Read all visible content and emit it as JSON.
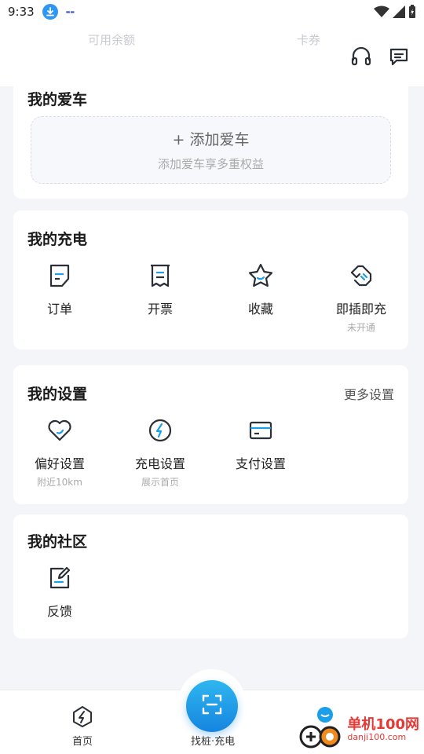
{
  "status_bar": {
    "time": "9:33"
  },
  "header": {
    "balance_label": "可用余额",
    "coupon_label": "卡券"
  },
  "my_car": {
    "title": "我的爱车",
    "add_label": "+ 添加爱车",
    "add_sub": "添加爱车享多重权益"
  },
  "my_charging": {
    "title": "我的充电",
    "items": [
      {
        "label": "订单",
        "icon": "order-icon"
      },
      {
        "label": "开票",
        "icon": "invoice-icon"
      },
      {
        "label": "收藏",
        "icon": "star-icon"
      },
      {
        "label": "即插即充",
        "sub": "未开通",
        "icon": "plug-icon"
      }
    ]
  },
  "my_settings": {
    "title": "我的设置",
    "more": "更多设置",
    "items": [
      {
        "label": "偏好设置",
        "sub": "附近10km",
        "icon": "heart-icon"
      },
      {
        "label": "充电设置",
        "sub": "展示首页",
        "icon": "bolt-icon"
      },
      {
        "label": "支付设置",
        "icon": "card-icon"
      }
    ]
  },
  "my_community": {
    "title": "我的社区",
    "items": [
      {
        "label": "反馈",
        "icon": "feedback-icon"
      }
    ]
  },
  "tabbar": {
    "home": "首页",
    "scan": "找桩·充电"
  },
  "watermark": {
    "name": "单机100网",
    "url": "danji100.com"
  },
  "colors": {
    "accent": "#1a9fe8",
    "icon_stroke": "#2b2f36"
  }
}
